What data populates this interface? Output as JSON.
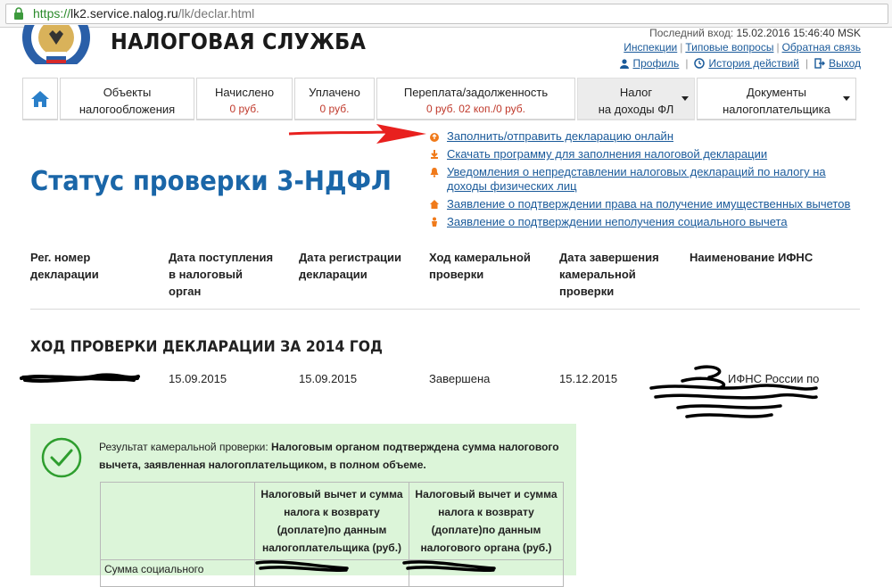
{
  "browser": {
    "url_proto": "https://",
    "url_host": "lk2.service.nalog.ru",
    "url_path": "/lk/declar.html"
  },
  "header": {
    "brand": "НАЛОГОВАЯ СЛУЖБА",
    "last_login_label": "Последний вход:",
    "last_login_value": "15.02.2016 15:46:40 MSK",
    "links": {
      "inspections": "Инспекции",
      "faq": "Типовые вопросы",
      "feedback": "Обратная связь",
      "profile": "Профиль",
      "history": "История действий",
      "logout": "Выход"
    }
  },
  "nav": {
    "tabs": [
      {
        "line1": "Объекты",
        "line2": "налогообложения"
      },
      {
        "line1": "Начислено",
        "line2": "0 руб."
      },
      {
        "line1": "Уплачено",
        "line2": "0 руб."
      },
      {
        "line1": "Переплата/задолженность",
        "line2": "0 руб. 02 коп./0 руб."
      },
      {
        "line1": "Налог",
        "line2": "на доходы ФЛ"
      },
      {
        "line1": "Документы",
        "line2": "налогоплательщика"
      }
    ]
  },
  "menu": {
    "items": [
      {
        "label": "Заполнить/отправить декларацию онлайн"
      },
      {
        "label": "Скачать программу для заполнения налоговой декларации"
      },
      {
        "label_line1": "Уведомления о непредставлении налоговых деклараций по налогу на",
        "label_line2": "доходы физических лиц"
      },
      {
        "label": "Заявление о подтверждении права на получение имущественных вычетов"
      },
      {
        "label": "Заявление о подтверждении неполучения социального вычета"
      }
    ]
  },
  "page": {
    "title": "Статус проверки 3-НДФЛ"
  },
  "table": {
    "columns": [
      [
        "Рег. номер",
        "декларации"
      ],
      [
        "Дата поступления",
        "в налоговый",
        "орган"
      ],
      [
        "Дата регистрации",
        "декларации"
      ],
      [
        "Ход камеральной",
        "проверки"
      ],
      [
        "Дата завершения",
        "камеральной",
        "проверки"
      ],
      [
        "Наименование ИФНС"
      ]
    ],
    "section_title": "ХОД ПРОВЕРКИ ДЕКЛАРАЦИИ ЗА 2014 ГОД",
    "row": {
      "received": "15.09.2015",
      "registered": "15.09.2015",
      "status": "Завершена",
      "completed": "15.12.2015",
      "ifns": "ИФНС России по"
    }
  },
  "result": {
    "prefix": "Результат камеральной проверки:",
    "bold_text": "Налоговым органом подтверждена сумма налогового вычета, заявленная налогоплательщиком, в полном объеме.",
    "col1": [
      "Налоговый вычет и сумма",
      "налога к возврату",
      "(доплате)по данным",
      "налогоплательщика (руб.)"
    ],
    "col2": [
      "Налоговый вычет и сумма",
      "налога к возврату",
      "(доплате)по данным",
      "налогового органа (руб.)"
    ],
    "row_label": "Сумма социального"
  },
  "colors": {
    "link": "#1a5a9a",
    "title": "#1a66a8",
    "amount": "#c0392b",
    "result_bg": "#dcf5d9",
    "check": "#2e9e2e",
    "arrow": "#e8201e"
  }
}
